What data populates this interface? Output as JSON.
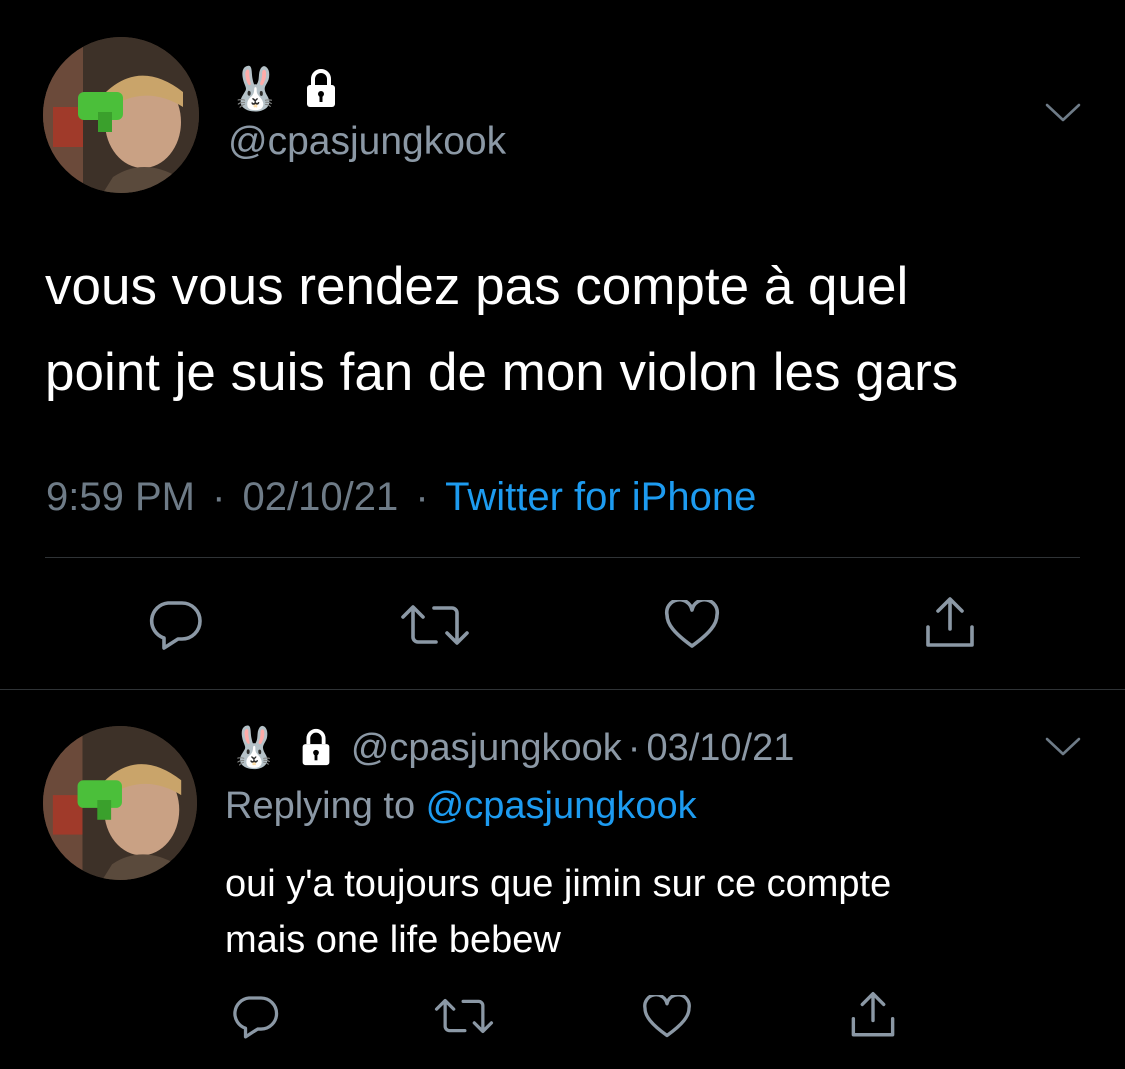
{
  "main_tweet": {
    "display_name_emoji": "🐰",
    "handle": "@cpasjungkook",
    "text_line1": "vous vous rendez pas compte à quel",
    "text_line2": "point je suis fan de mon violon les gars",
    "time": "9:59 PM",
    "separator": "·",
    "date": "02/10/21",
    "source": "Twitter for iPhone"
  },
  "reply_tweet": {
    "display_name_emoji": "🐰",
    "handle": "@cpasjungkook",
    "separator": "·",
    "date": "03/10/21",
    "replying_prefix": "Replying to ",
    "replying_handle": "@cpasjungkook",
    "text_line1": "oui y'a toujours que jimin sur ce compte",
    "text_line2": "mais one life bebew"
  },
  "icons": {
    "reply": "reply-icon",
    "retweet": "retweet-icon",
    "like": "heart-icon",
    "share": "share-icon",
    "lock": "lock-icon",
    "more": "chevron-down-icon"
  },
  "colors": {
    "background": "#000000",
    "text": "#ffffff",
    "secondary": "#6e7b87",
    "link": "#1d9bf0",
    "divider": "#2f3336"
  }
}
